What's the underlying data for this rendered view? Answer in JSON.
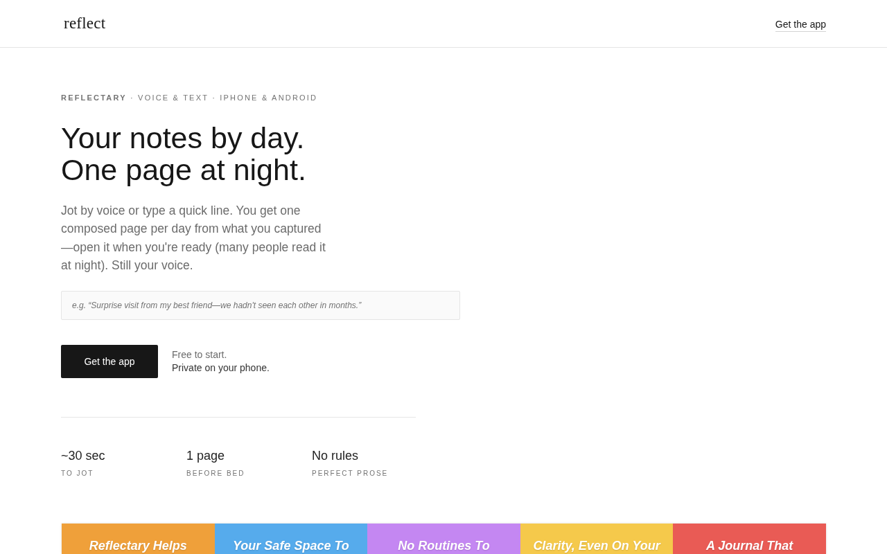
{
  "header": {
    "logo": "reflect",
    "link": "Get the app"
  },
  "hero": {
    "eyebrow": "**REFLECTARY** · VOICE & TEXT · IPHONE & ANDROID",
    "headline": [
      "Your notes by day.",
      "One page at night."
    ],
    "intro": "Jot by voice or type a quick line. You get one composed page per day from what you captured —open it when you're ready (many people read it at night). Still your voice.",
    "input": {
      "placeholder": "e.g. “Surprise visit from my best friend—we hadn't seen each other in months.”"
    },
    "button": "Get the app",
    "note": "Free to start.",
    "subnote": "Private on your phone."
  },
  "stats": [
    {
      "value": "~30 sec",
      "label": "TO JOT"
    },
    {
      "value": "1 page",
      "label": "BEFORE BED"
    },
    {
      "value": "No rules",
      "label": "PERFECT PROSE"
    }
  ],
  "cards": [
    {
      "title": "Reflectary Helps",
      "color": "#efa03a"
    },
    {
      "title": "Your Safe Space To",
      "color": "#56abec"
    },
    {
      "title": "No Routines To",
      "color": "#c487f2"
    },
    {
      "title": "Clarity, Even On Your",
      "color": "#f5c94b"
    },
    {
      "title": "A Journal That",
      "color": "#e95b55"
    }
  ]
}
